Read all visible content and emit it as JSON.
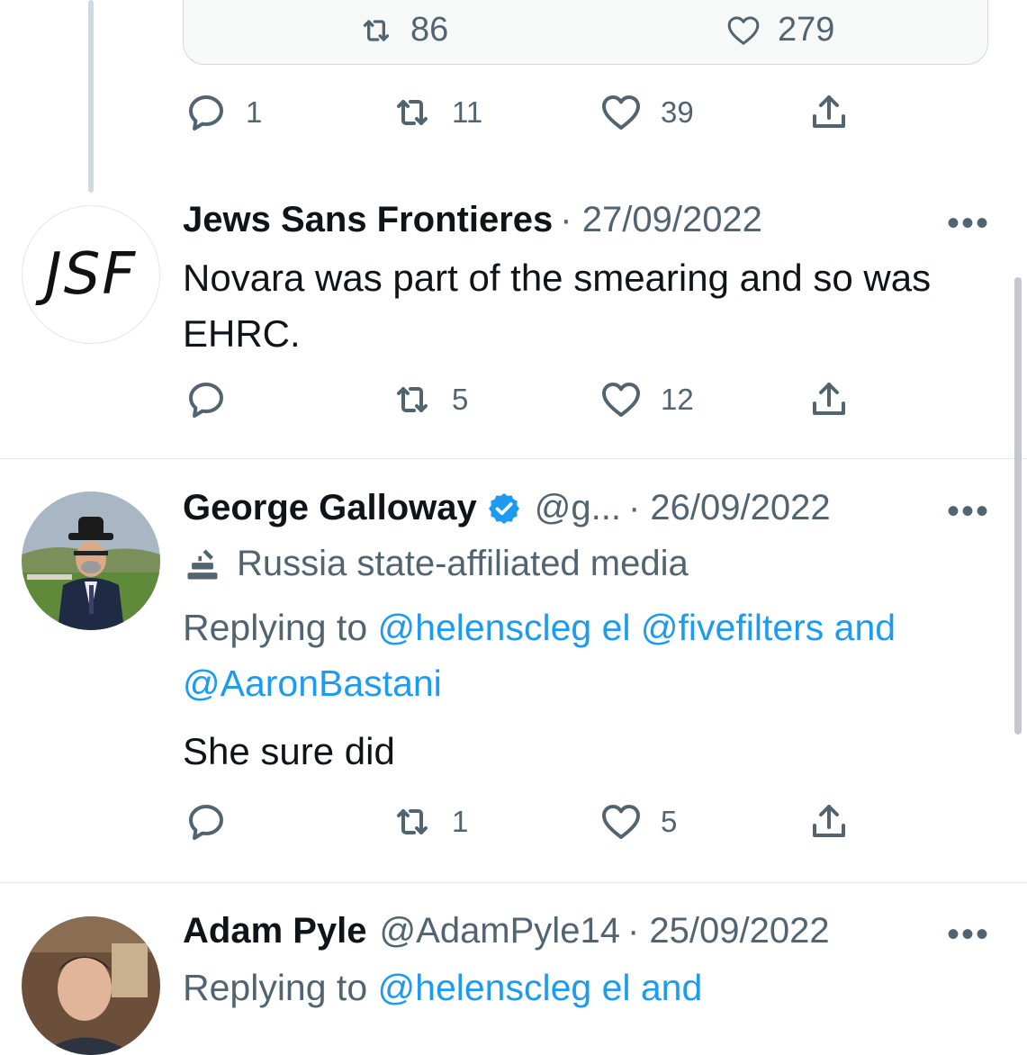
{
  "quoted_card": {
    "retweets": "86",
    "likes": "279"
  },
  "tweet0_actions": {
    "replies": "1",
    "retweets": "11",
    "likes": "39"
  },
  "tweet1": {
    "name": "Jews Sans Frontieres",
    "date": "· 27/09/2022",
    "avatar_text": "JSF",
    "text_line1": "Novara was part of the smearing and so was",
    "text_line2": "EHRC.",
    "retweets": "5",
    "likes": "12"
  },
  "tweet2": {
    "name": "George Galloway",
    "handle": "@g...",
    "date": "· 26/09/2022",
    "label": "Russia state-affiliated media",
    "replying_to": "Replying to",
    "mention1": "@helenscleg el",
    "mention2": "@fivefilters and",
    "mention3": "@AaronBastani",
    "text": "She sure did",
    "retweets": "1",
    "likes": "5"
  },
  "tweet3": {
    "name": "Adam Pyle",
    "handle": "@AdamPyle14",
    "date": "· 25/09/2022",
    "replying_to": "Replying to",
    "mention1": "@helenscleg el and"
  },
  "more_label": "•••",
  "colors": {
    "link": "#1d9bf0",
    "verified": "#1d9bf0",
    "gray": "#536471"
  }
}
